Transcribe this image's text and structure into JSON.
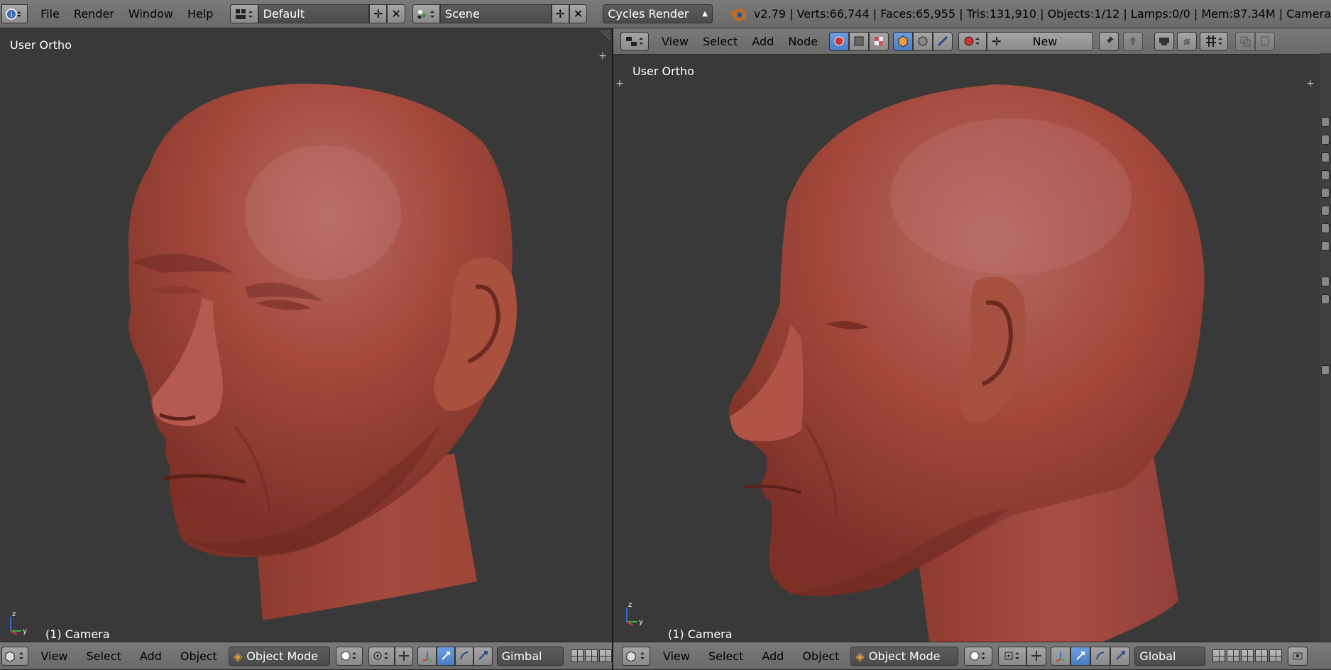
{
  "top_bar": {
    "menus": [
      "File",
      "Render",
      "Window",
      "Help"
    ],
    "screen_layout": "Default",
    "scene": "Scene",
    "render_engine": "Cycles Render",
    "stats": "v2.79 | Verts:66,744 | Faces:65,955 | Tris:131,910 | Objects:1/12 | Lamps:0/0 | Mem:87.34M | Camera"
  },
  "node_header": {
    "menus": [
      "View",
      "Select",
      "Add",
      "Node"
    ],
    "new_button": "New"
  },
  "left_viewport": {
    "view_label": "User Ortho",
    "object_label": "(1) Camera"
  },
  "right_viewport": {
    "view_label": "User Ortho",
    "object_label": "(1) Camera"
  },
  "left_footer": {
    "menus": [
      "View",
      "Select",
      "Add",
      "Object"
    ],
    "mode": "Object Mode",
    "orientation": "Gimbal"
  },
  "right_footer": {
    "menus": [
      "View",
      "Select",
      "Add",
      "Object"
    ],
    "mode": "Object Mode",
    "orientation": "Global"
  },
  "colors": {
    "skin": "#a5483a",
    "skin_light": "#b45c50",
    "skin_dark": "#7a3026",
    "viewport_bg": "#393939",
    "header_bg": "#727272",
    "active_blue": "#5a8ad0"
  }
}
